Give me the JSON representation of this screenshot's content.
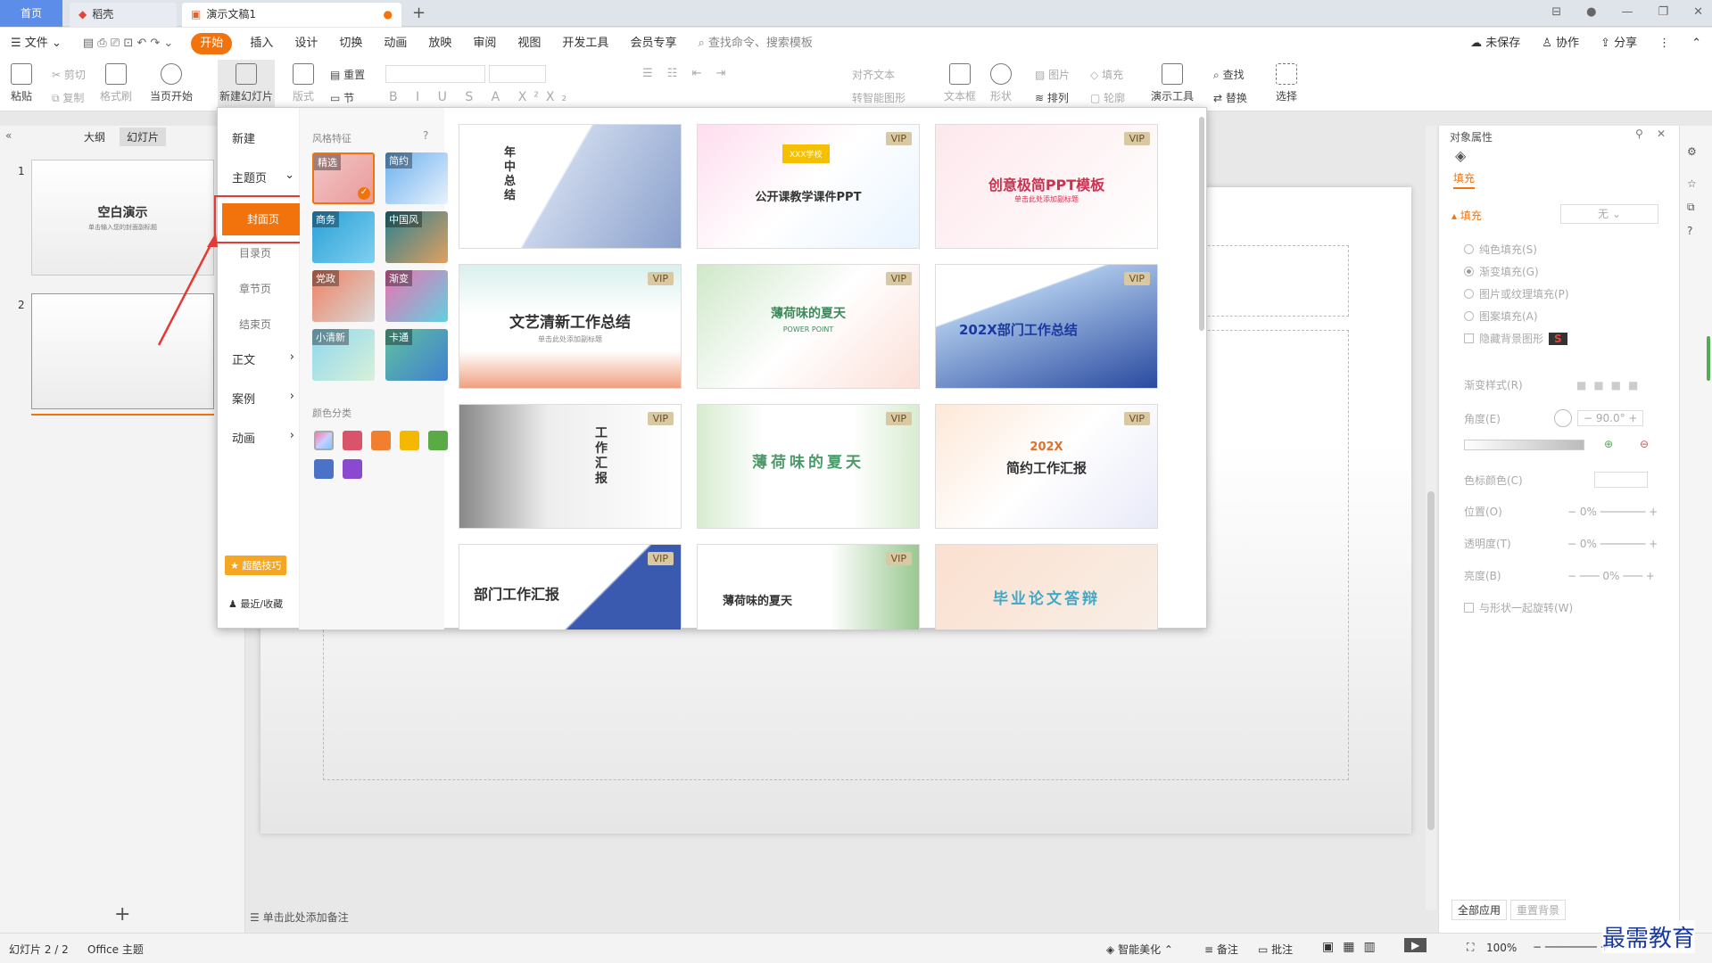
{
  "tabs": {
    "home": "首页",
    "daoke": "稻壳",
    "doc": "演示文稿1"
  },
  "menu": {
    "file": "文件",
    "items": [
      "开始",
      "插入",
      "设计",
      "切换",
      "动画",
      "放映",
      "审阅",
      "视图",
      "开发工具",
      "会员专享"
    ],
    "search": "查找命令、搜索模板",
    "unsaved": "未保存",
    "collab": "协作",
    "share": "分享"
  },
  "ribbon": {
    "paste": "粘贴",
    "cut": "剪切",
    "copy": "复制",
    "format_painter": "格式刷",
    "from_current": "当页开始",
    "new_slide": "新建幻灯片",
    "layout": "版式",
    "reset": "重置",
    "section": "节",
    "text_box": "文本框",
    "shape": "形状",
    "picture": "图片",
    "fill": "填充",
    "arrange": "排列",
    "outline": "轮廓",
    "presentation_tools": "演示工具",
    "find": "查找",
    "replace": "替换",
    "select": "选择",
    "align_text": "对齐文本",
    "smart_shape": "转智能图形"
  },
  "left_panel": {
    "tab_outline": "大纲",
    "tab_slides": "幻灯片",
    "slide1_title": "空白演示",
    "slide1_sub": "单击输入您的封面副标题",
    "slide_nums": [
      "1",
      "2"
    ]
  },
  "popup": {
    "nav": {
      "new": "新建",
      "theme": "主题页",
      "cover": "封面页",
      "toc": "目录页",
      "chapter": "章节页",
      "end": "结束页",
      "body": "正文",
      "case": "案例",
      "animation": "动画",
      "tips": "超酷技巧",
      "recent": "最近/收藏"
    },
    "style_label": "风格特征",
    "styles": [
      "精选",
      "简约",
      "商务",
      "中国风",
      "党政",
      "渐变",
      "小清新",
      "卡通"
    ],
    "color_label": "颜色分类",
    "colors": [
      "#c8a0f0",
      "#d9546a",
      "#f08030",
      "#f5b800",
      "#5aaa46",
      "#4a72c8",
      "#8a4ad0"
    ],
    "templates": [
      {
        "title": "年中总结",
        "vip": ""
      },
      {
        "title": "公开课教学课件PPT",
        "badge": "XXX学校",
        "vip": "VIP"
      },
      {
        "title": "创意极简PPT模板",
        "sub": "单击此处添加副标题",
        "vip": "VIP"
      },
      {
        "title": "文艺清新工作总结",
        "sub": "单击此处添加副标题",
        "vip": "VIP"
      },
      {
        "title": "薄荷味的夏天",
        "sub": "POWER POINT",
        "vip": "VIP"
      },
      {
        "title": "202X部门工作总结",
        "vip": "VIP"
      },
      {
        "title": "工作汇报",
        "vip": "VIP"
      },
      {
        "title": "薄荷味的夏天",
        "vip": "VIP"
      },
      {
        "title": "简约工作汇报",
        "pre": "202X",
        "vip": "VIP"
      },
      {
        "title": "部门工作汇报",
        "vip": "VIP"
      },
      {
        "title": "薄荷味的夏天",
        "vip": "VIP"
      },
      {
        "title": "毕业论文答辩",
        "vip": ""
      }
    ]
  },
  "right_panel": {
    "title": "对象属性",
    "tab_fill": "填充",
    "fill_label": "填充",
    "fill_value": "无",
    "options": [
      "纯色填充(S)",
      "渐变填充(G)",
      "图片或纹理填充(P)",
      "图案填充(A)"
    ],
    "hide_bg": "隐藏背景图形",
    "gradient_style": "渐变样式(R)",
    "angle": "角度(E)",
    "angle_value": "90.0°",
    "stop_color": "色标颜色(C)",
    "position": "位置(O)",
    "transparency": "透明度(T)",
    "brightness": "亮度(B)",
    "pct": "0%",
    "rotate": "与形状一起旋转(W)",
    "apply_all": "全部应用",
    "reset_bg": "重置背景"
  },
  "status": {
    "slide": "幻灯片 2 / 2",
    "theme": "Office 主题",
    "beautify": "智能美化",
    "notes": "备注",
    "comments": "批注",
    "zoom": "100%",
    "notes_placeholder": "单击此处添加备注",
    "watermark": "最需教育"
  }
}
